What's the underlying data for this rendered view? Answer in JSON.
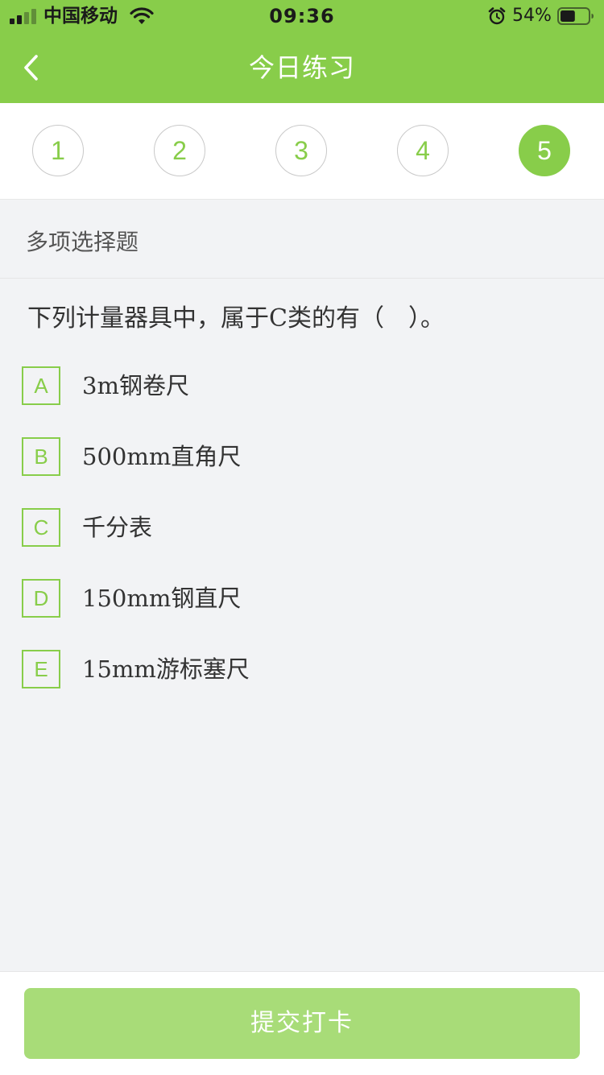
{
  "status_bar": {
    "carrier": "中国移动",
    "time": "09:36",
    "battery_percent": "54%",
    "battery_level": 0.54
  },
  "nav": {
    "back_icon": "chevron-left-icon",
    "title": "今日练习"
  },
  "question_nav": {
    "items": [
      "1",
      "2",
      "3",
      "4",
      "5"
    ],
    "active_index": 4
  },
  "question": {
    "type_label": "多项选择题",
    "text": "下列计量器具中，属于C类的有（　）。",
    "options": [
      {
        "letter": "A",
        "text": "3m钢卷尺"
      },
      {
        "letter": "B",
        "text": "500mm直角尺"
      },
      {
        "letter": "C",
        "text": "千分表"
      },
      {
        "letter": "D",
        "text": "150mm钢直尺"
      },
      {
        "letter": "E",
        "text": "15mm游标塞尺"
      }
    ]
  },
  "footer": {
    "submit_label": "提交打卡"
  },
  "colors": {
    "brand_green": "#88cd4a",
    "submit_disabled": "#a8dc78",
    "background": "#f2f3f5"
  }
}
